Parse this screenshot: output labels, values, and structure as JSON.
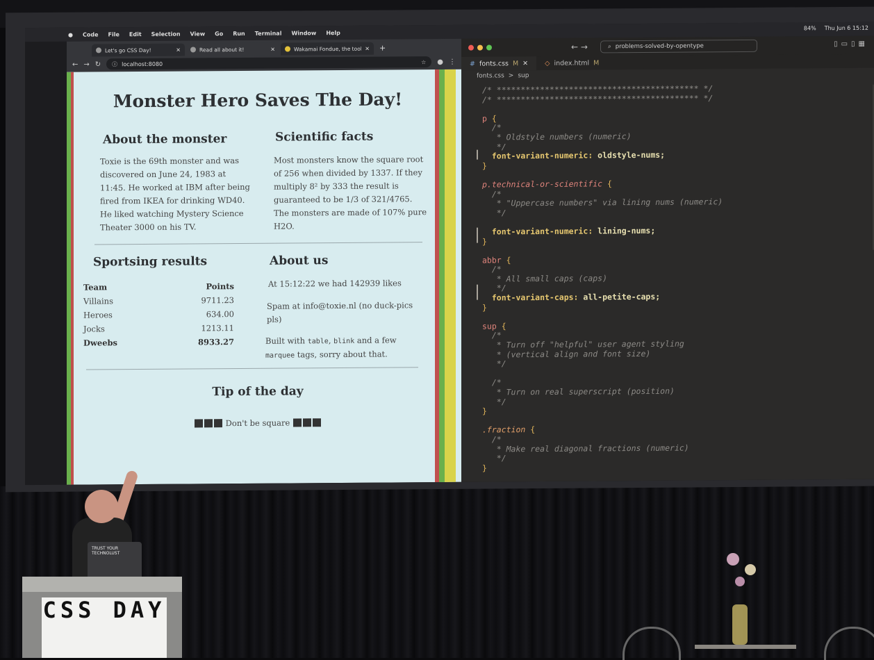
{
  "menubar": {
    "app": "Code",
    "items": [
      "File",
      "Edit",
      "Selection",
      "View",
      "Go",
      "Run",
      "Terminal",
      "Window",
      "Help"
    ],
    "battery": "84%",
    "datetime": "Thu Jun 6  15:12"
  },
  "browser": {
    "tabs": [
      {
        "title": "Let's go CSS Day!",
        "icon": "globe-icon"
      },
      {
        "title": "Read all about it!",
        "icon": "globe-icon"
      },
      {
        "title": "Wakamai Fondue, the tool th",
        "icon": "wakamai-icon"
      }
    ],
    "url": "localhost:8080"
  },
  "page": {
    "title": "Monster Hero Saves The Day!",
    "about_monster": {
      "heading": "About the monster",
      "text": "Toxie is the 69th monster and was discovered on June 24, 1983 at 11:45. He worked at IBM after being fired from IKEA for drinking WD40. He liked watching Mystery Science Theater 3000 on his TV."
    },
    "scientific": {
      "heading": "Scientific facts",
      "text": "Most monsters know the square root of 256 when divided by 1337. If they multiply 8² by 333 the result is guaranteed to be 1/3 of 321/4765. The monsters are made of 107% pure H2O."
    },
    "sports": {
      "heading": "Sportsing results",
      "columns": [
        "Team",
        "Points"
      ],
      "rows": [
        [
          "Villains",
          "9711.23"
        ],
        [
          "Heroes",
          "634.00"
        ],
        [
          "Jocks",
          "1213.11"
        ],
        [
          "Dweebs",
          "8933.27"
        ]
      ]
    },
    "about_us": {
      "heading": "About us",
      "likes": "At 15:12:22 we had 142939 likes",
      "spam": "Spam at info@toxie.nl (no duck-pics pls)",
      "built_prefix": "Built with ",
      "built_table": "table",
      "built_comma": ", ",
      "built_blink": "blink",
      "built_mid": " and a few ",
      "built_marquee": "marquee",
      "built_suffix": " tags, sorry about that."
    },
    "tip": {
      "heading": "Tip of the day",
      "text": "Don't be square"
    }
  },
  "editor": {
    "search": "problems-solved-by-opentype",
    "tabs": [
      {
        "name": "fonts.css",
        "status": "M"
      },
      {
        "name": "index.html",
        "status": "M"
      }
    ],
    "breadcrumb": [
      "fonts.css",
      ">",
      "sup"
    ],
    "code": {
      "l1": "/* ****************************************** */",
      "l2": "/* ****************************************** */",
      "p_sel": "p",
      "p_c1": "  /*",
      "p_c2": "   * Oldstyle numbers (numeric)",
      "p_c3": "   */",
      "p_prop": "  font-variant-numeric:",
      "p_val": " oldstyle-nums;",
      "tech_sel": "p.technical-or-scientific",
      "tech_c2": "   * \"Uppercase numbers\" via lining nums (numeric)",
      "tech_prop": "  font-variant-numeric:",
      "tech_val": " lining-nums;",
      "abbr_sel": "abbr",
      "abbr_c2": "   * All small caps (caps)",
      "abbr_prop": "  font-variant-caps:",
      "abbr_val": " all-petite-caps;",
      "sup_sel": "sup",
      "sup_c2": "   * Turn off \"helpful\" user agent styling",
      "sup_c3": "   * (vertical align and font size)",
      "sup_c5": "   * Turn on real superscript (position)",
      "frac_sel": ".fraction",
      "frac_c2": "   * Make real diagonal fractions (numeric)",
      "open": " {",
      "close": "}"
    }
  },
  "stage": {
    "podium_logo": "CSS DAY",
    "laptop_sticker": "TRUST YOUR TECHNOLUST"
  }
}
